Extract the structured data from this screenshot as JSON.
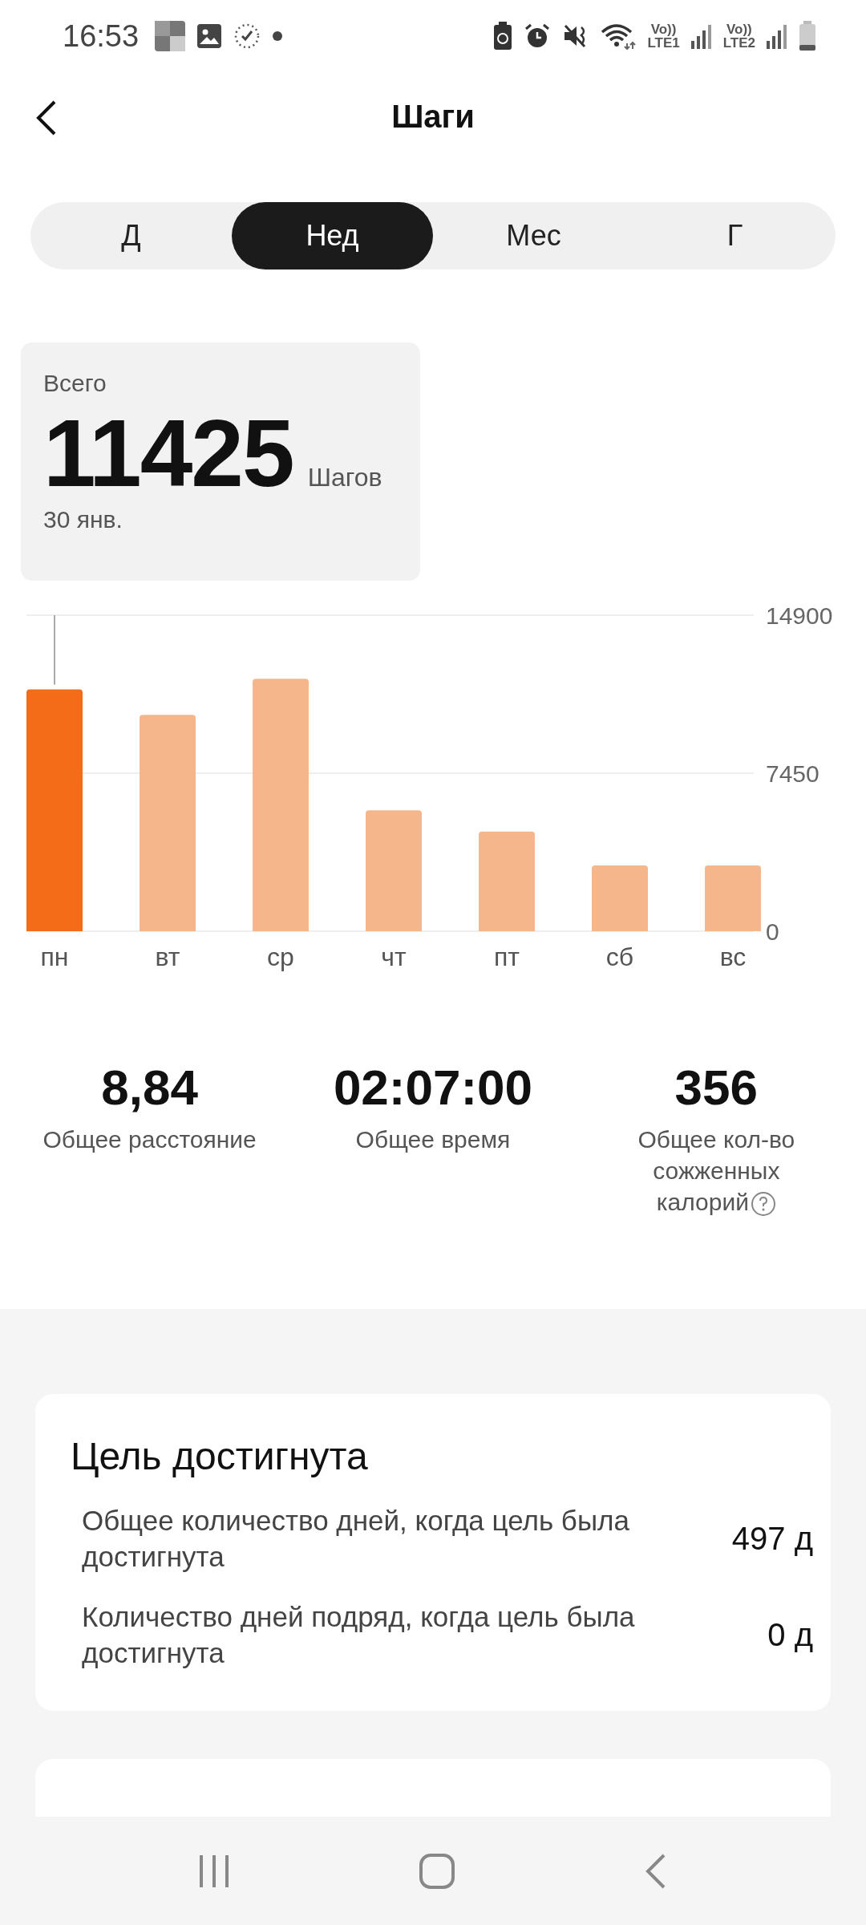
{
  "status_bar": {
    "time": "16:53",
    "network": [
      {
        "top": "Vo))",
        "bottom": "LTE1"
      },
      {
        "top": "Vo))",
        "bottom": "LTE2"
      }
    ]
  },
  "header": {
    "title": "Шаги"
  },
  "tabs": [
    {
      "label": "Д",
      "selected": false
    },
    {
      "label": "Нед",
      "selected": true
    },
    {
      "label": "Мес",
      "selected": false
    },
    {
      "label": "Г",
      "selected": false
    }
  ],
  "summary": {
    "caption": "Всего",
    "value": "11425",
    "unit": "Шагов",
    "date": "30 янв."
  },
  "chart": {
    "bars_selected": [
      true,
      false,
      false,
      false,
      false,
      false,
      false
    ],
    "chart_data": {
      "type": "bar",
      "categories": [
        "пн",
        "вт",
        "ср",
        "чт",
        "пт",
        "сб",
        "вс"
      ],
      "series": [
        {
          "color": "#f56c18",
          "values": [
            11400,
            null,
            null,
            null,
            null,
            null,
            null
          ]
        },
        {
          "color": "#f6b68c",
          "values": [
            null,
            10200,
            11900,
            5700,
            4700,
            3100,
            3100
          ]
        }
      ],
      "ylim": [
        0,
        14900
      ],
      "yticks": [
        0,
        7450,
        14900
      ]
    }
  },
  "stats": [
    {
      "value": "8,84",
      "label": "Общее расстояние",
      "help": false
    },
    {
      "value": "02:07:00",
      "label": "Общее время",
      "help": false
    },
    {
      "value": "356",
      "label": "Общее кол-во сожженных калорий",
      "help": true
    }
  ],
  "goal_card": {
    "title": "Цель достигнута",
    "rows": [
      {
        "label": "Общее количество дней, когда цель была достигнута",
        "value": "497 д"
      },
      {
        "label": "Количество дней подряд, когда цель была достигнута",
        "value": "0 д"
      }
    ]
  },
  "weekly_card": {
    "kind": "card"
  }
}
